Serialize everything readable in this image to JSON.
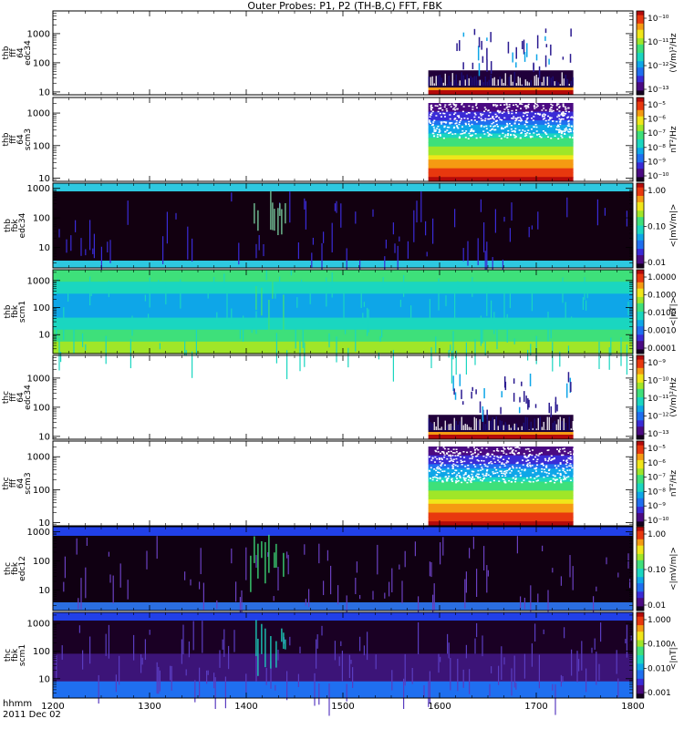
{
  "title": "Outer Probes: P1, P2 (TH-B,C) FFT, FBK",
  "xaxis": {
    "ticks": [
      "1200",
      "1300",
      "1400",
      "1500",
      "1600",
      "1700",
      "1800"
    ],
    "label_time": "hhmm",
    "label_date": "2011 Dec 02"
  },
  "chart_data": [
    {
      "type": "heatmap",
      "ylabel": [
        "thb",
        "fff",
        "64",
        "edc34"
      ],
      "yscale": "log",
      "ylim": [
        8,
        6000
      ],
      "ytick_labels": [
        "10",
        "100",
        "1000"
      ],
      "colorbar": {
        "label": "(V/m)²/Hz",
        "ticks": [
          "10⁻¹³",
          "10⁻¹²",
          "10⁻¹¹",
          "10⁻¹⁰"
        ]
      },
      "data_window": [
        "1553",
        "1723"
      ],
      "pattern": "sparse"
    },
    {
      "type": "heatmap",
      "ylabel": [
        "thb",
        "fff",
        "64",
        "scm3"
      ],
      "yscale": "log",
      "ylim": [
        8,
        3000
      ],
      "ytick_labels": [
        "10",
        "100",
        "1000"
      ],
      "colorbar": {
        "label": "nT²/Hz",
        "ticks": [
          "10⁻¹⁰",
          "10⁻⁹",
          "10⁻⁸",
          "10⁻⁷",
          "10⁻⁶",
          "10⁻⁵"
        ]
      },
      "data_window": [
        "1553",
        "1723"
      ],
      "pattern": "dense"
    },
    {
      "type": "heatmap",
      "ylabel": [
        "thb",
        "fbk",
        "edc34"
      ],
      "yscale": "log",
      "ylim": [
        2,
        1500
      ],
      "ytick_labels": [
        "10",
        "100",
        "1000"
      ],
      "colorbar": {
        "label": "<|mV/m|>",
        "ticks": [
          "0.01",
          "0.10",
          "1.00"
        ]
      },
      "data_window": [
        "1200",
        "1800"
      ],
      "pattern": "fbk_e"
    },
    {
      "type": "heatmap",
      "ylabel": [
        "thb",
        "fbk",
        "scm1"
      ],
      "yscale": "log",
      "ylim": [
        2,
        2500
      ],
      "ytick_labels": [
        "10",
        "100",
        "1000"
      ],
      "colorbar": {
        "label": "<|nT|>",
        "ticks": [
          "0.0001",
          "0.0010",
          "0.0100",
          "0.1000",
          "1.0000"
        ]
      },
      "data_window": [
        "1200",
        "1800"
      ],
      "pattern": "fbk_b"
    },
    {
      "type": "heatmap",
      "ylabel": [
        "thc",
        "fff",
        "64",
        "edc34"
      ],
      "yscale": "log",
      "ylim": [
        8,
        6000
      ],
      "ytick_labels": [
        "10",
        "100",
        "1000"
      ],
      "colorbar": {
        "label": "(V/m)²/Hz",
        "ticks": [
          "10⁻¹³",
          "10⁻¹²",
          "10⁻¹¹",
          "10⁻¹⁰",
          "10⁻⁹"
        ]
      },
      "data_window": [
        "1553",
        "1723"
      ],
      "pattern": "sparse"
    },
    {
      "type": "heatmap",
      "ylabel": [
        "thc",
        "fff",
        "64",
        "scm3"
      ],
      "yscale": "log",
      "ylim": [
        8,
        3000
      ],
      "ytick_labels": [
        "10",
        "100",
        "1000"
      ],
      "colorbar": {
        "label": "nT²/Hz",
        "ticks": [
          "10⁻¹⁰",
          "10⁻⁹",
          "10⁻⁸",
          "10⁻⁷",
          "10⁻⁶",
          "10⁻⁵"
        ]
      },
      "data_window": [
        "1553",
        "1723"
      ],
      "pattern": "dense"
    },
    {
      "type": "heatmap",
      "ylabel": [
        "thc",
        "fbk",
        "edc12"
      ],
      "yscale": "log",
      "ylim": [
        2,
        1500
      ],
      "ytick_labels": [
        "10",
        "100",
        "1000"
      ],
      "colorbar": {
        "label": "<|mV/m|>",
        "ticks": [
          "0.01",
          "0.10",
          "1.00"
        ]
      },
      "data_window": [
        "1200",
        "1800"
      ],
      "pattern": "fbk_e2"
    },
    {
      "type": "heatmap",
      "ylabel": [
        "thc",
        "fbk",
        "scm1"
      ],
      "yscale": "log",
      "ylim": [
        2,
        2500
      ],
      "ytick_labels": [
        "10",
        "100",
        "1000"
      ],
      "colorbar": {
        "label": "<|nT|>",
        "ticks": [
          "0.001",
          "0.010",
          "0.100",
          "1.000"
        ]
      },
      "data_window": [
        "1200",
        "1800"
      ],
      "pattern": "fbk_b2"
    }
  ]
}
